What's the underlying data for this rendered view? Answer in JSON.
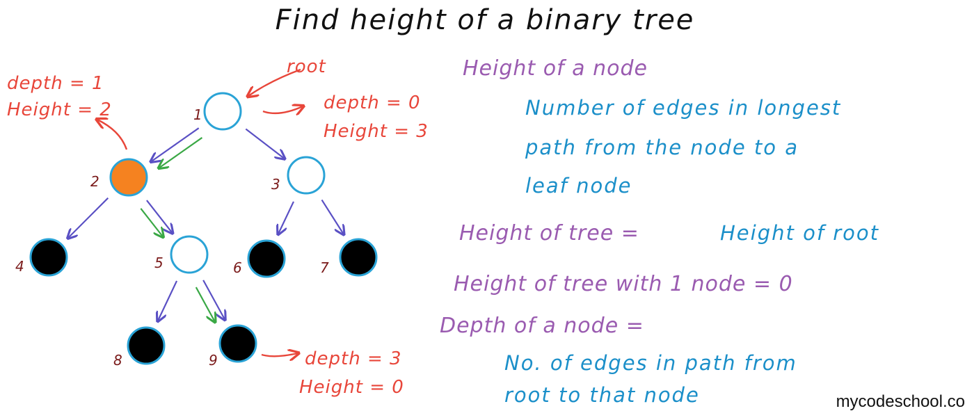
{
  "title": "Find height of a binary tree",
  "colors": {
    "ink": "#111111",
    "red": "#e8463a",
    "purple": "#9a5bb0",
    "blue": "#1b8fc9",
    "node_outline": "#2aa3d6",
    "highlight": "#f58220",
    "leaf": "#000000",
    "edge": "#5a50c4",
    "path": "#3aa845",
    "num": "#7a1a1a"
  },
  "tree": {
    "nodes": [
      {
        "id": "1",
        "label": "1",
        "type": "hollow"
      },
      {
        "id": "2",
        "label": "2",
        "type": "highlight"
      },
      {
        "id": "3",
        "label": "3",
        "type": "hollow"
      },
      {
        "id": "4",
        "label": "4",
        "type": "leaf"
      },
      {
        "id": "5",
        "label": "5",
        "type": "hollow"
      },
      {
        "id": "6",
        "label": "6",
        "type": "leaf"
      },
      {
        "id": "7",
        "label": "7",
        "type": "leaf"
      },
      {
        "id": "8",
        "label": "8",
        "type": "leaf"
      },
      {
        "id": "9",
        "label": "9",
        "type": "leaf"
      }
    ],
    "edges": [
      {
        "from": "1",
        "to": "2"
      },
      {
        "from": "1",
        "to": "3"
      },
      {
        "from": "2",
        "to": "4"
      },
      {
        "from": "2",
        "to": "5"
      },
      {
        "from": "3",
        "to": "6"
      },
      {
        "from": "3",
        "to": "7"
      },
      {
        "from": "5",
        "to": "8"
      },
      {
        "from": "5",
        "to": "9"
      }
    ],
    "longest_path": [
      "1",
      "2",
      "5",
      "9"
    ]
  },
  "annotations": {
    "root": "root",
    "node1_depth": "depth = 0",
    "node1_height": "Height = 3",
    "node2_depth": "depth = 1",
    "node2_height": "Height = 2",
    "node9_depth": "depth = 3",
    "node9_height": "Height = 0"
  },
  "definitions": {
    "height_node_title": "Height of a node",
    "height_node_line1": "Number of edges in longest",
    "height_node_line2": "path from the node to a",
    "height_node_line3": "leaf node",
    "height_tree_left": "Height of tree =",
    "height_tree_right": "Height of root",
    "height_tree_one": "Height of tree with 1 node = 0",
    "depth_title": "Depth of a node =",
    "depth_line1": "No. of edges in path from",
    "depth_line2": "root to that node"
  },
  "footer": "mycodeschool.co"
}
